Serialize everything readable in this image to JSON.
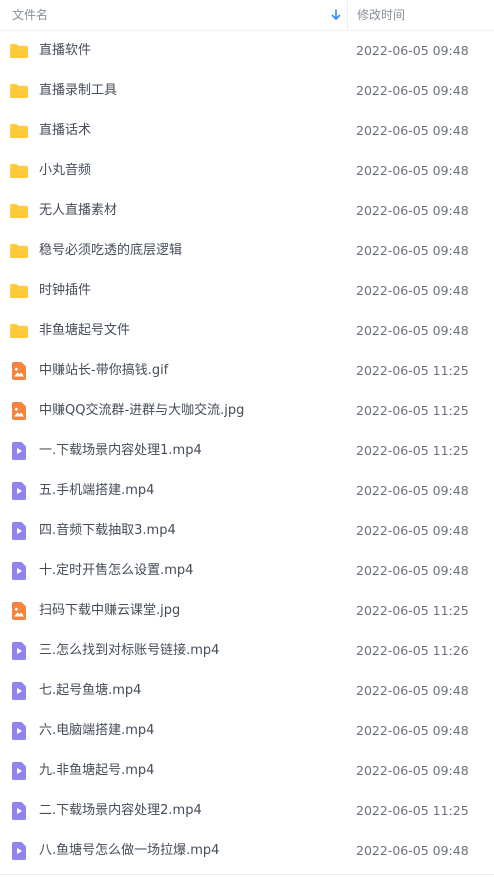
{
  "header": {
    "name_label": "文件名",
    "date_label": "修改时间",
    "sort_icon": "arrow-down-icon"
  },
  "colors": {
    "folder": "#ffc93a",
    "image_file": "#f5843f",
    "video_file": "#8f84f0"
  },
  "files": [
    {
      "name": "直播软件",
      "date": "2022-06-05 09:48",
      "type": "folder"
    },
    {
      "name": "直播录制工具",
      "date": "2022-06-05 09:48",
      "type": "folder"
    },
    {
      "name": "直播话术",
      "date": "2022-06-05 09:48",
      "type": "folder"
    },
    {
      "name": "小丸音频",
      "date": "2022-06-05 09:48",
      "type": "folder"
    },
    {
      "name": "无人直播素材",
      "date": "2022-06-05 09:48",
      "type": "folder"
    },
    {
      "name": "稳号必须吃透的底层逻辑",
      "date": "2022-06-05 09:48",
      "type": "folder"
    },
    {
      "name": "时钟插件",
      "date": "2022-06-05 09:48",
      "type": "folder"
    },
    {
      "name": "非鱼塘起号文件",
      "date": "2022-06-05 09:48",
      "type": "folder"
    },
    {
      "name": "中赚站长-带你搞钱.gif",
      "date": "2022-06-05 11:25",
      "type": "image"
    },
    {
      "name": "中赚QQ交流群-进群与大咖交流.jpg",
      "date": "2022-06-05 11:25",
      "type": "image"
    },
    {
      "name": "一.下载场景内容处理1.mp4",
      "date": "2022-06-05 11:25",
      "type": "video"
    },
    {
      "name": "五.手机端搭建.mp4",
      "date": "2022-06-05 09:48",
      "type": "video"
    },
    {
      "name": "四.音频下载抽取3.mp4",
      "date": "2022-06-05 09:48",
      "type": "video"
    },
    {
      "name": "十.定时开售怎么设置.mp4",
      "date": "2022-06-05 09:48",
      "type": "video"
    },
    {
      "name": "扫码下载中赚云课堂.jpg",
      "date": "2022-06-05 11:25",
      "type": "image"
    },
    {
      "name": "三.怎么找到对标账号链接.mp4",
      "date": "2022-06-05 11:26",
      "type": "video"
    },
    {
      "name": "七.起号鱼塘.mp4",
      "date": "2022-06-05 09:48",
      "type": "video"
    },
    {
      "name": "六.电脑端搭建.mp4",
      "date": "2022-06-05 09:48",
      "type": "video"
    },
    {
      "name": "九.非鱼塘起号.mp4",
      "date": "2022-06-05 09:48",
      "type": "video"
    },
    {
      "name": "二.下载场景内容处理2.mp4",
      "date": "2022-06-05 11:25",
      "type": "video"
    },
    {
      "name": "八.鱼塘号怎么做一场拉爆.mp4",
      "date": "2022-06-05 09:48",
      "type": "video"
    }
  ]
}
